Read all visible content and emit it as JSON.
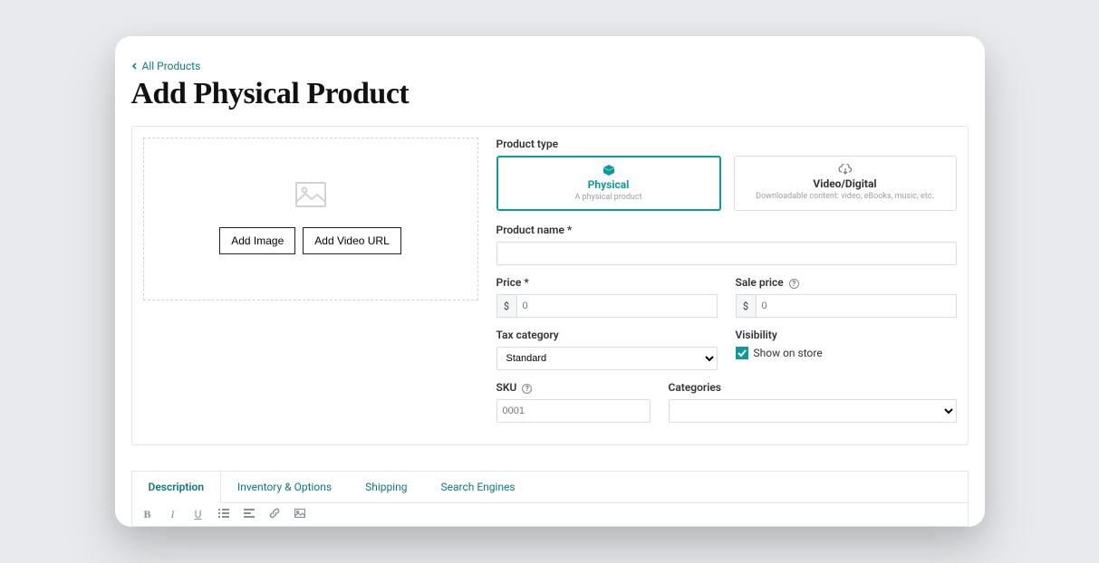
{
  "breadcrumb": {
    "label": "All Products"
  },
  "page_title": "Add Physical Product",
  "media": {
    "add_image_label": "Add Image",
    "add_video_label": "Add Video URL"
  },
  "product_type": {
    "label": "Product type",
    "options": [
      {
        "title": "Physical",
        "subtitle": "A physical product",
        "icon": "box-icon",
        "selected": true
      },
      {
        "title": "Video/Digital",
        "subtitle": "Downloadable content: video, eBooks, music, etc.",
        "icon": "cloud-download-icon",
        "selected": false
      }
    ]
  },
  "product_name": {
    "label": "Product name *",
    "value": ""
  },
  "price": {
    "label": "Price *",
    "currency": "$",
    "placeholder": "0",
    "value": ""
  },
  "sale_price": {
    "label": "Sale price",
    "currency": "$",
    "placeholder": "0",
    "value": ""
  },
  "tax_category": {
    "label": "Tax category",
    "value": "Standard"
  },
  "visibility": {
    "label": "Visibility",
    "checkbox_label": "Show on store",
    "checked": true
  },
  "sku": {
    "label": "SKU",
    "placeholder": "0001",
    "value": ""
  },
  "categories": {
    "label": "Categories",
    "value": ""
  },
  "tabs": [
    {
      "label": "Description",
      "active": true
    },
    {
      "label": "Inventory & Options",
      "active": false
    },
    {
      "label": "Shipping",
      "active": false
    },
    {
      "label": "Search Engines",
      "active": false
    }
  ],
  "editor_toolbar": {
    "bold": "B",
    "italic": "I",
    "underline": "U"
  }
}
